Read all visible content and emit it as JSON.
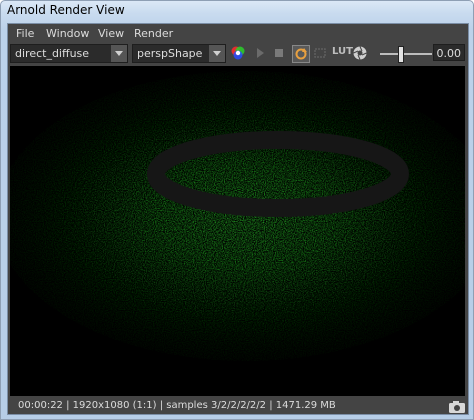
{
  "window": {
    "title": "Arnold Render View"
  },
  "menu": [
    "File",
    "Window",
    "View",
    "Render"
  ],
  "toolbar": {
    "aov_value": "direct_diffuse",
    "camera_value": "perspShape",
    "lut_label": "LUT",
    "exposure_value": "0.00",
    "exposure_level": 0.5
  },
  "icons": {
    "channels": "color-channels-icon",
    "play": "play-icon",
    "stop": "stop-icon",
    "refresh": "refresh-icon",
    "crop": "crop-region-icon",
    "exposure": "aperture-icon",
    "snapshot": "camera-icon"
  },
  "render": {
    "background": "#000000",
    "light_color": "#1fae1f",
    "ring_color": "#161616"
  },
  "status": {
    "text": "00:00:22 | 1920x1080 (1:1) | samples 3/2/2/2/2/2 | 1471.29 MB"
  }
}
